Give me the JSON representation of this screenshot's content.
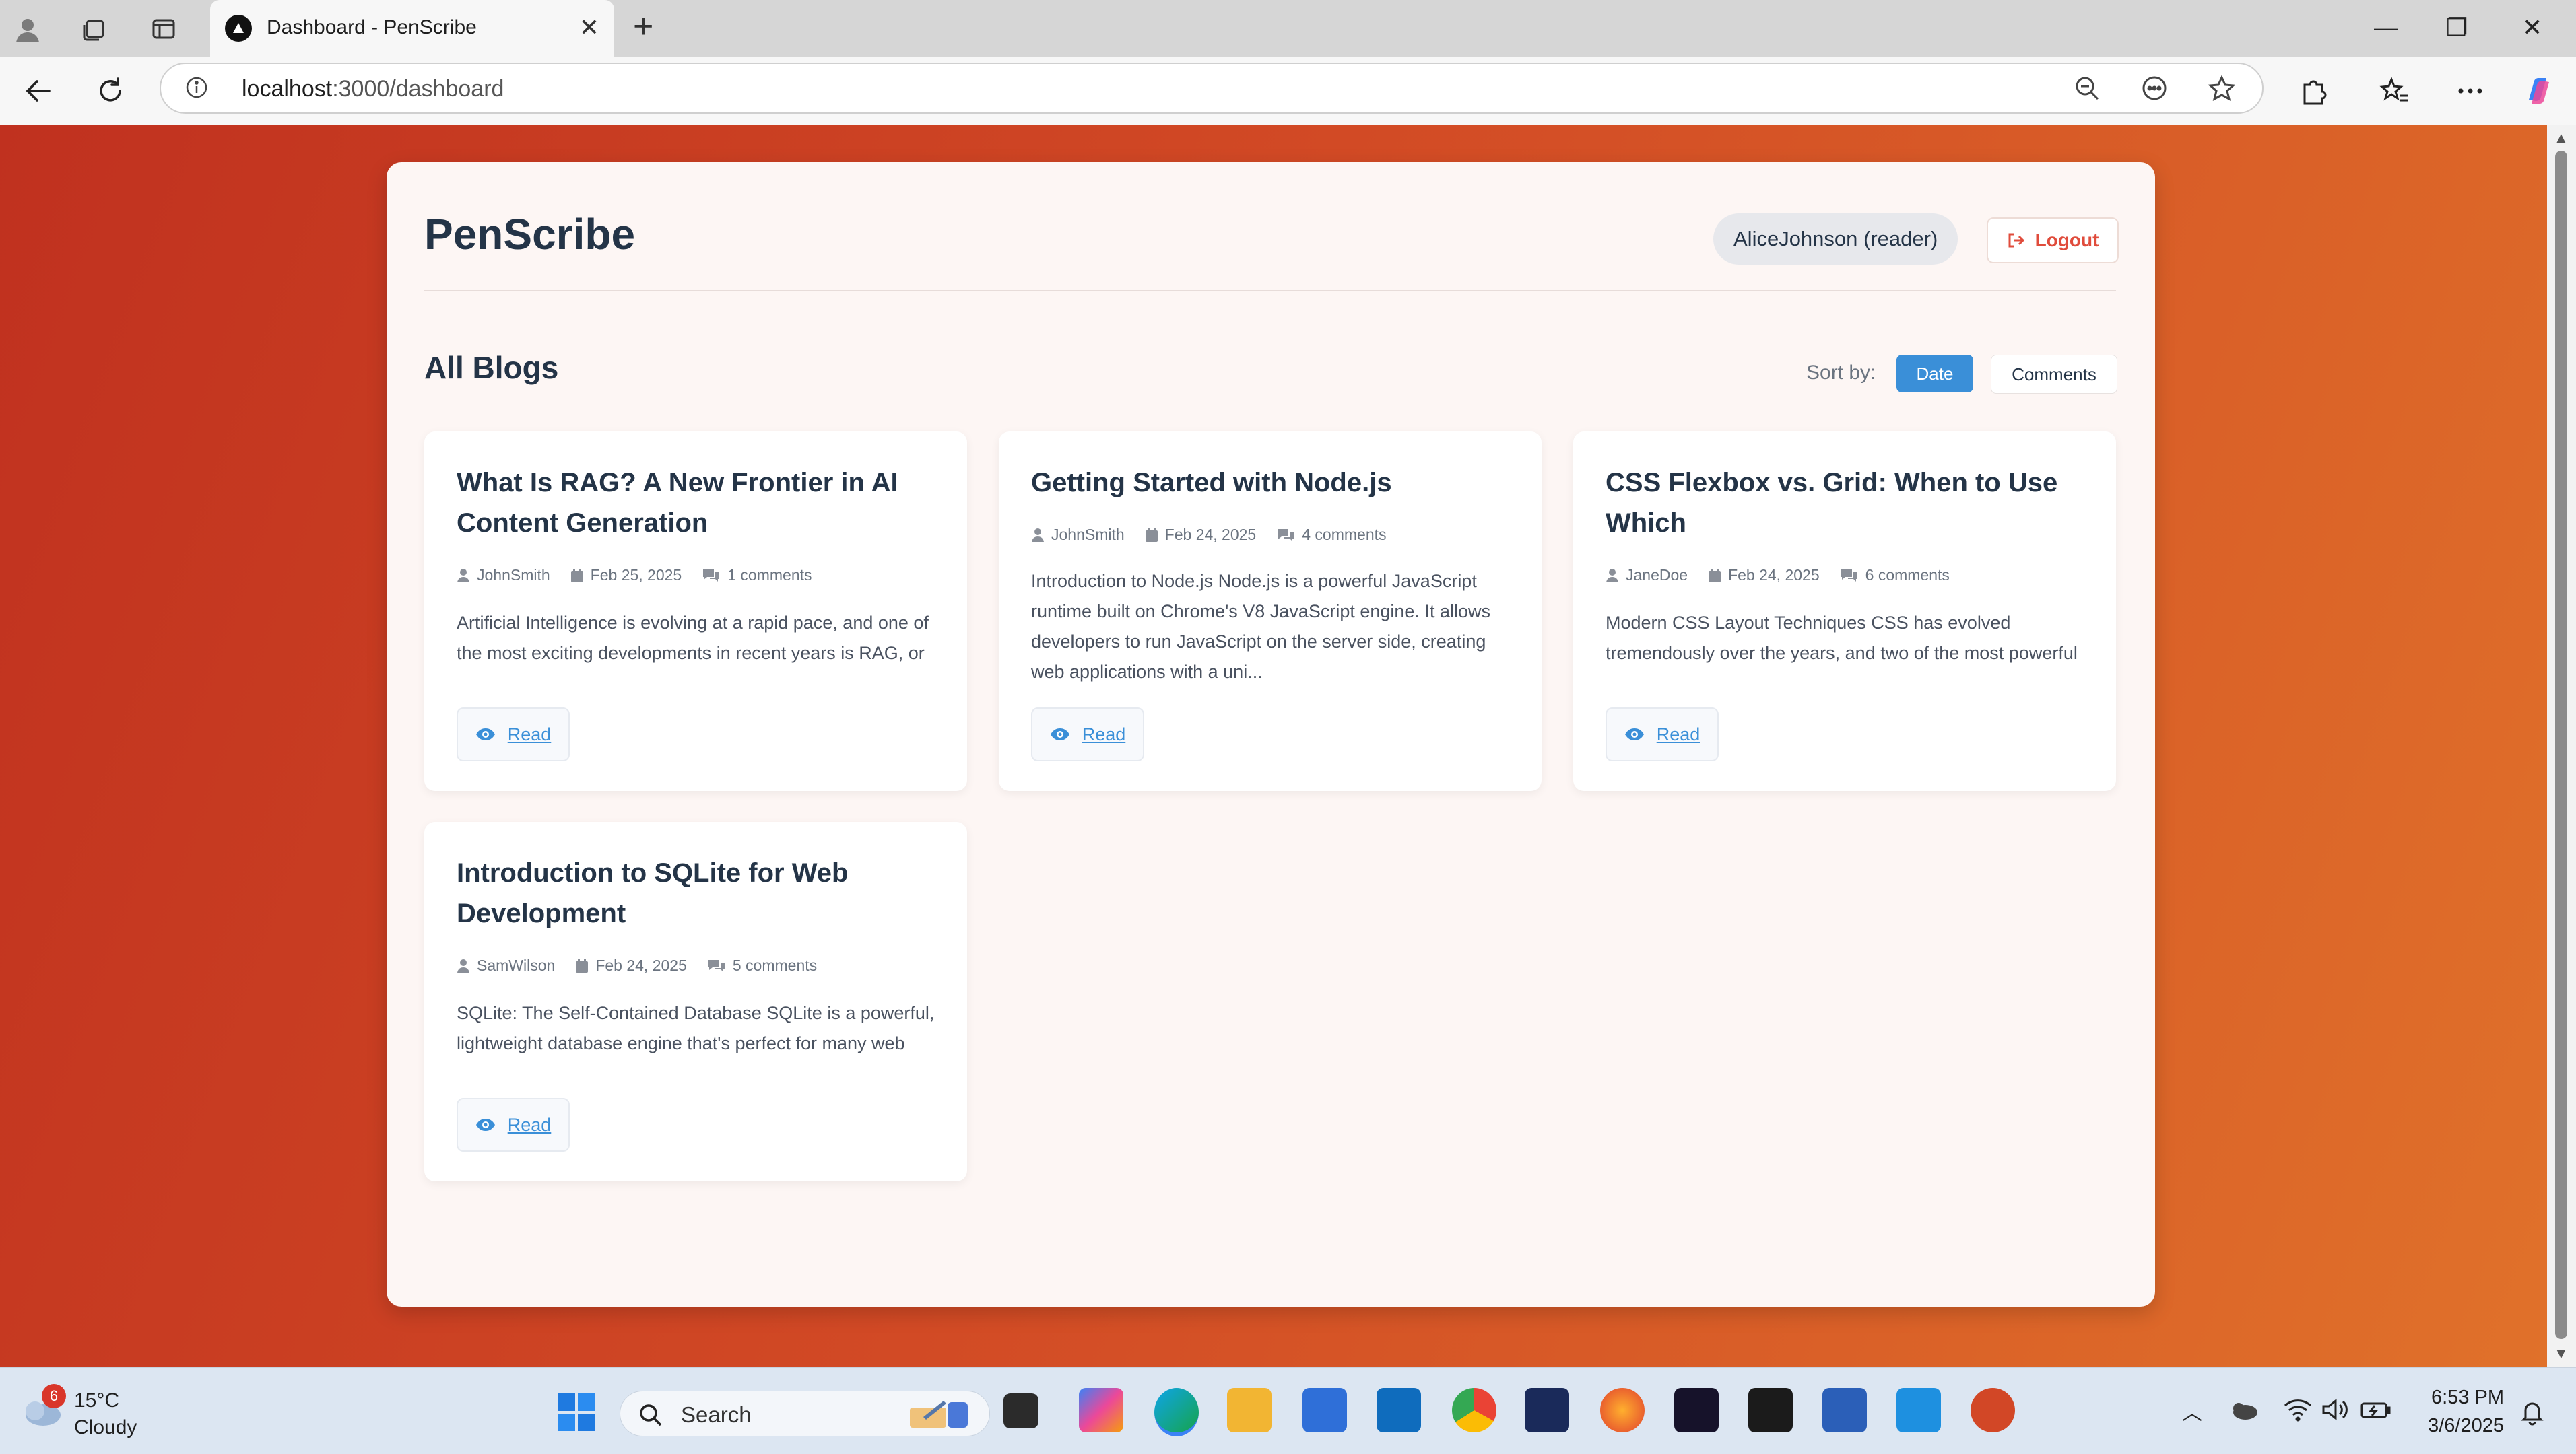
{
  "browser": {
    "tab_title": "Dashboard - PenScribe",
    "url_host": "localhost",
    "url_path": ":3000/dashboard"
  },
  "app": {
    "brand": "PenScribe",
    "user_label": "AliceJohnson (reader)",
    "logout_label": "Logout",
    "section_title": "All Blogs",
    "sort_label": "Sort by:",
    "sort_date": "Date",
    "sort_comments": "Comments",
    "read_label": "Read",
    "accent_color": "#3a8fd8",
    "logout_color": "#e04c3c"
  },
  "blogs": [
    {
      "title": "What Is RAG? A New Frontier in AI Content Generation",
      "author": "JohnSmith",
      "date": "Feb 25, 2025",
      "comments": "1 comments",
      "excerpt": "Artificial Intelligence is evolving at a rapid pace, and one of the most exciting developments in recent years is RAG, or Retrieval-Augmented Generation. This innovative"
    },
    {
      "title": "Getting Started with Node.js",
      "author": "JohnSmith",
      "date": "Feb 24, 2025",
      "comments": "4 comments",
      "excerpt": "Introduction to Node.js Node.js is a powerful JavaScript runtime built on Chrome's V8 JavaScript engine. It allows developers to run JavaScript on the server side, creating web applications with a uni..."
    },
    {
      "title": "CSS Flexbox vs. Grid: When to Use Which",
      "author": "JaneDoe",
      "date": "Feb 24, 2025",
      "comments": "6 comments",
      "excerpt": "Modern CSS Layout Techniques CSS has evolved tremendously over the years, and two of the most powerful layout systems available to web developers"
    },
    {
      "title": "Introduction to SQLite for Web Development",
      "author": "SamWilson",
      "date": "Feb 24, 2025",
      "comments": "5 comments",
      "excerpt": "SQLite: The Self-Contained Database SQLite is a powerful, lightweight database engine that's perfect for many web applications. Unlike traditional database"
    }
  ],
  "taskbar": {
    "weather_temp": "15°C",
    "weather_cond": "Cloudy",
    "weather_badge": "6",
    "search_placeholder": "Search",
    "time": "6:53 PM",
    "date": "3/6/2025"
  }
}
